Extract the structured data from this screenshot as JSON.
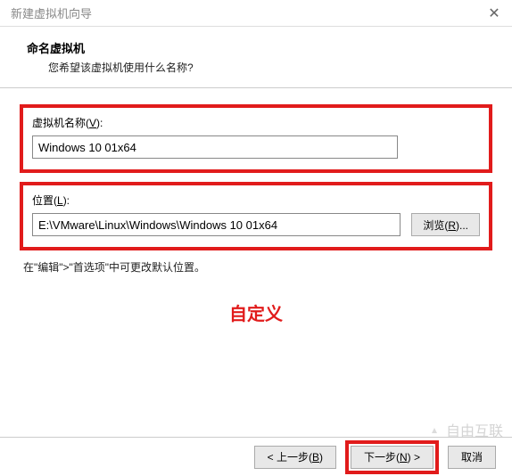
{
  "titlebar": {
    "title": "新建虚拟机向导",
    "close": "✕"
  },
  "header": {
    "title": "命名虚拟机",
    "subtitle": "您希望该虚拟机使用什么名称?"
  },
  "fields": {
    "name_label_pre": "虚拟机名称(",
    "name_label_key": "V",
    "name_label_post": "):",
    "name_value": "Windows 10 01x64",
    "location_label_pre": "位置(",
    "location_label_key": "L",
    "location_label_post": "):",
    "location_value": "E:\\VMware\\Linux\\Windows\\Windows 10 01x64",
    "browse_pre": "浏览(",
    "browse_key": "R",
    "browse_post": ")...",
    "note": "在\"编辑\">\"首选项\"中可更改默认位置。"
  },
  "annotation": "自定义",
  "footer": {
    "back_pre": "< 上一步(",
    "back_key": "B",
    "back_post": ")",
    "next_pre": "下一步(",
    "next_key": "N",
    "next_post": ") >",
    "cancel": "取消"
  },
  "watermark": "自由互联"
}
